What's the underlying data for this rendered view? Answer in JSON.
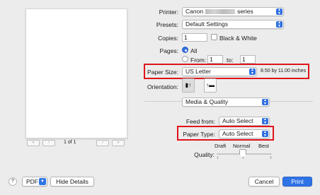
{
  "preview": {
    "page_indicator": "1 of 1",
    "nav_first": "«",
    "nav_prev": "‹",
    "nav_next": "›",
    "nav_last": "»"
  },
  "printer": {
    "label": "Printer:",
    "value_prefix": "Canon",
    "value_suffix": "series"
  },
  "presets": {
    "label": "Presets:",
    "value": "Default Settings"
  },
  "copies": {
    "label": "Copies:",
    "value": "1",
    "bw_label": "Black & White"
  },
  "pages": {
    "label": "Pages:",
    "all_label": "All",
    "from_label": "From:",
    "from_value": "1",
    "to_label": "to:",
    "to_value": "1"
  },
  "paper_size": {
    "label": "Paper Size:",
    "value": "US Letter",
    "dimensions": "8.50 by 11.00 inches"
  },
  "orientation": {
    "label": "Orientation:"
  },
  "section": {
    "value": "Media & Quality"
  },
  "feed_from": {
    "label": "Feed from:",
    "value": "Auto Select"
  },
  "paper_type": {
    "label": "Paper Type:",
    "value": "Auto Select"
  },
  "quality": {
    "label": "Quality:",
    "draft": "Draft",
    "normal": "Normal",
    "best": "Best"
  },
  "bottom": {
    "help": "?",
    "pdf": "PDF",
    "hide_details": "Hide Details",
    "cancel": "Cancel",
    "print": "Print"
  },
  "colors": {
    "accent": "#2f74e6",
    "highlight": "#e0121b"
  }
}
